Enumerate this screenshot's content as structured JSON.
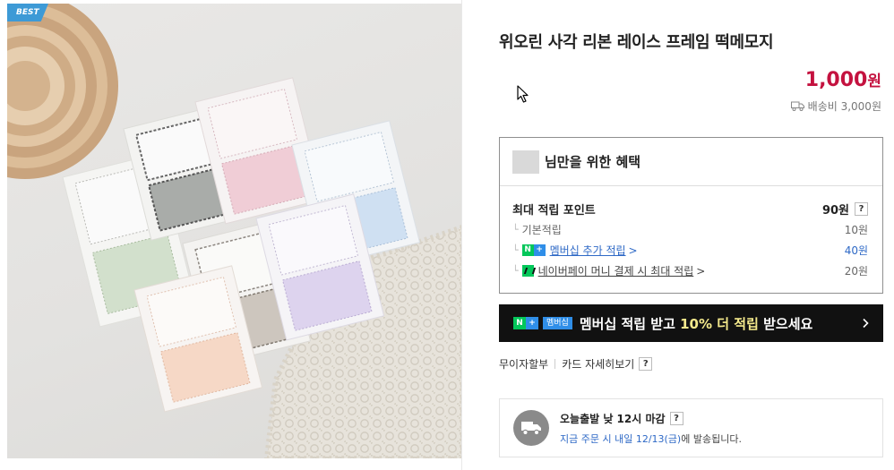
{
  "badge": "BEST",
  "product": {
    "title": "위오린 사각 리본 레이스 프레임 떡메모지",
    "price_number": "1,000",
    "price_unit": "원",
    "shipping": "배송비 3,000원"
  },
  "benefit": {
    "title": "님만을 위한 혜택",
    "max_points_label": "최대 적립 포인트",
    "max_points_value": "90원",
    "help": "?",
    "rows": [
      {
        "label": "기본적립",
        "value": "10원"
      },
      {
        "label": "멤버십 추가 적립",
        "value": "40원",
        "badge": [
          "N",
          "+"
        ]
      },
      {
        "label": "네이버페이 머니 결제 시 최대 적립",
        "value": "20원"
      }
    ],
    "chevron": ">"
  },
  "banner": {
    "tag": "멤버십",
    "text_before": "멤버십 적립 받고 ",
    "text_highlight": "10% 더 적립",
    "text_after": " 받으세요"
  },
  "pay_links": {
    "installment": "무이자할부",
    "card_benefits": "카드 자세히보기",
    "help": "?"
  },
  "delivery": {
    "line1": "오늘출발 낮 12시 마감",
    "help": "?",
    "line2_blue": "지금 주문 시 내일 12/13(금)",
    "line2_rest": "에 발송됩니다."
  },
  "colors": {
    "price": "#c4123f",
    "link_blue": "#2e69c6",
    "naver_green": "#03c75a",
    "badge_blue": "#3d9ad6",
    "banner_bg": "#111111",
    "banner_highlight": "#f4e98c"
  },
  "icons": {
    "cursor": "mouse-pointer-icon",
    "shipping": "truck-icon",
    "banner_arrow": "chevron-right-icon"
  }
}
